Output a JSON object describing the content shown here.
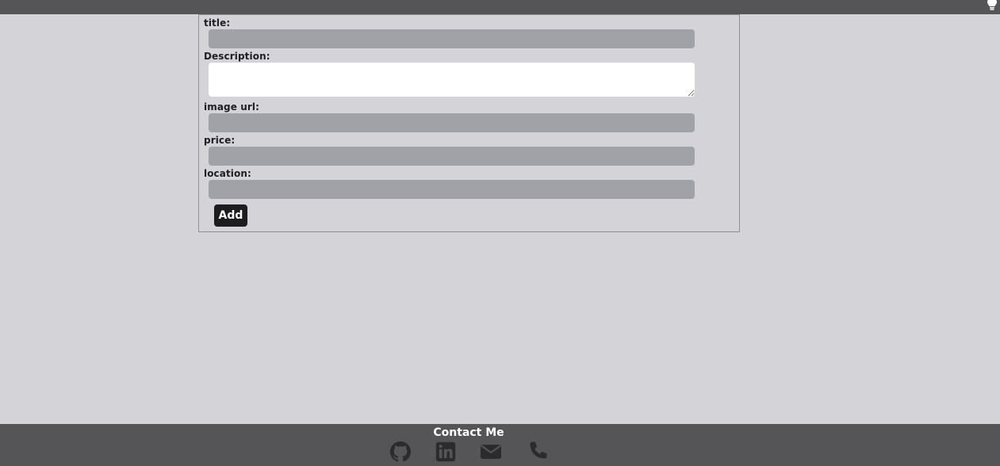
{
  "header": {
    "theme_toggle_icon": "lightbulb-icon"
  },
  "form": {
    "title_label": "title:",
    "title_value": "",
    "description_label": "Description:",
    "description_value": "",
    "image_url_label": "image url:",
    "image_url_value": "",
    "price_label": "price:",
    "price_value": "",
    "location_label": "location:",
    "location_value": "",
    "add_button_label": "Add"
  },
  "footer": {
    "title": "Contact Me",
    "icons": [
      "github-icon",
      "linkedin-icon",
      "email-icon",
      "phone-icon"
    ]
  },
  "colors": {
    "background": "#d4d3d8",
    "bar": "#555457",
    "input": "#a1a1a8",
    "button": "#1d1d20"
  }
}
